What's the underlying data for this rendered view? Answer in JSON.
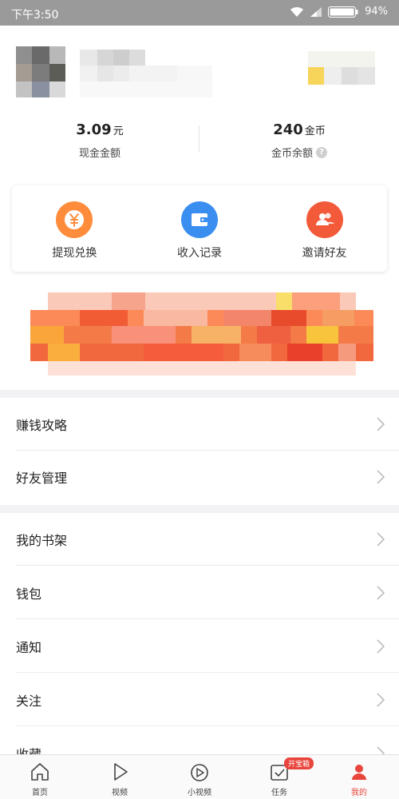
{
  "status_bar": {
    "time": "下午3:50",
    "battery": "94%"
  },
  "balances": [
    {
      "value": "3.09",
      "unit": "元",
      "label": "现金金额",
      "has_help": false
    },
    {
      "value": "240",
      "unit": "金币",
      "label": "金币余额",
      "has_help": true
    }
  ],
  "help_icon_glyph": "?",
  "actions": [
    {
      "label": "提现兑换",
      "icon": "yuan-icon",
      "color": "#ff8c3b"
    },
    {
      "label": "收入记录",
      "icon": "wallet-icon",
      "color": "#3a8ef0"
    },
    {
      "label": "邀请好友",
      "icon": "friends-icon",
      "color": "#f25a3a"
    }
  ],
  "menu_group_1": [
    "赚钱攻略",
    "好友管理"
  ],
  "menu_group_2": [
    "我的书架",
    "钱包",
    "通知",
    "关注",
    "收藏"
  ],
  "bottom_nav": [
    {
      "label": "首页",
      "icon": "home-icon",
      "active": false
    },
    {
      "label": "视频",
      "icon": "play-icon",
      "active": false
    },
    {
      "label": "小视频",
      "icon": "short-video-icon",
      "active": false
    },
    {
      "label": "任务",
      "icon": "task-icon",
      "active": false,
      "badge": "开宝箱"
    },
    {
      "label": "我的",
      "icon": "profile-icon",
      "active": true
    }
  ],
  "colors": {
    "accent": "#e8453c",
    "section_gap": "#f2f2f4"
  }
}
